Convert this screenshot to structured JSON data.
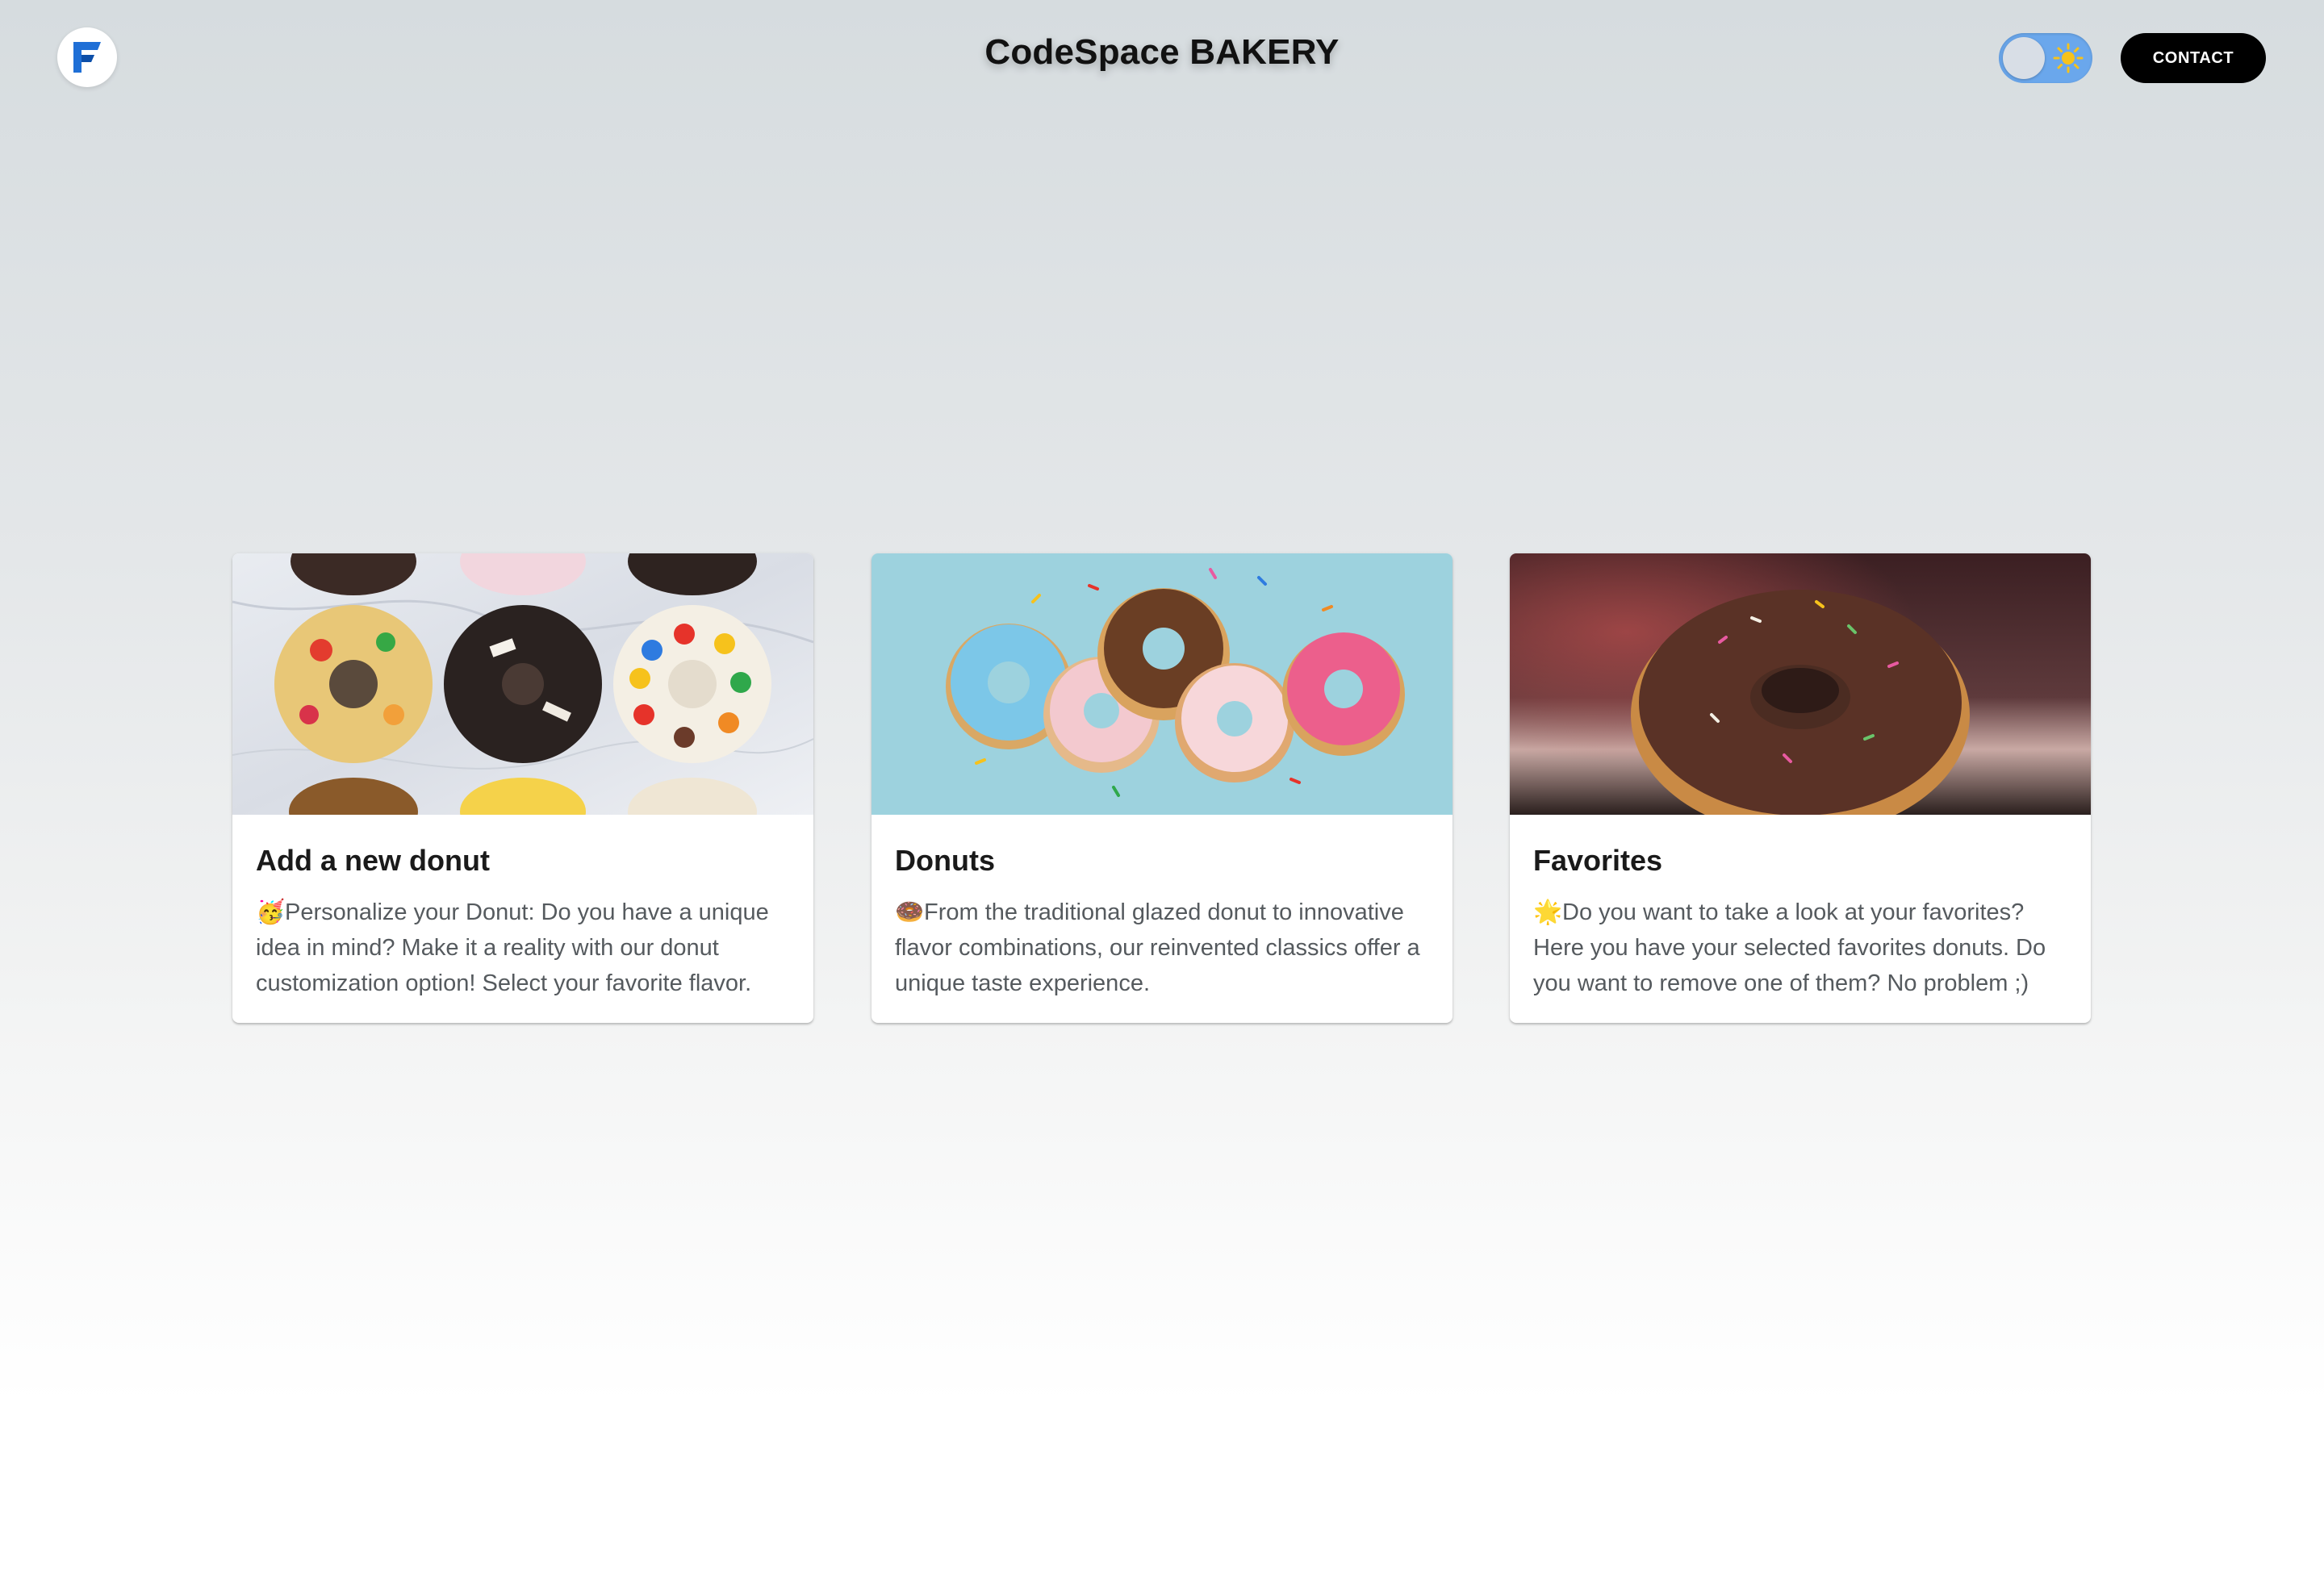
{
  "header": {
    "title": "CodeSpace BAKERY",
    "contact_label": "CONTACT",
    "logo_icon": "letter-f-logo-icon",
    "theme_toggle": {
      "state": "light",
      "icon": "sun-icon"
    }
  },
  "cards": [
    {
      "title": "Add a new donut",
      "emoji": "🥳",
      "text": "Personalize your Donut: Do you have a unique idea in mind? Make it a reality with our donut customization option! Select your favorite flavor.",
      "image_subject": "assorted topped donuts on marble"
    },
    {
      "title": "Donuts",
      "emoji": "🍩",
      "text": "From the traditional glazed donut to innovative flavor combinations, our reinvented classics offer a unique taste experience.",
      "image_subject": "flying glazed donuts with sprinkles"
    },
    {
      "title": "Favorites",
      "emoji": "🌟",
      "text": "Do you want to take a look at your favorites? Here you have your selected favorites donuts. Do you want to remove one of them? No problem ;)",
      "image_subject": "chocolate donut with sprinkles"
    }
  ],
  "colors": {
    "accent_blue": "#1f6fd6",
    "toggle_bg": "#6aa7ec",
    "sun": "#f6c21c",
    "button_bg": "#000000"
  }
}
